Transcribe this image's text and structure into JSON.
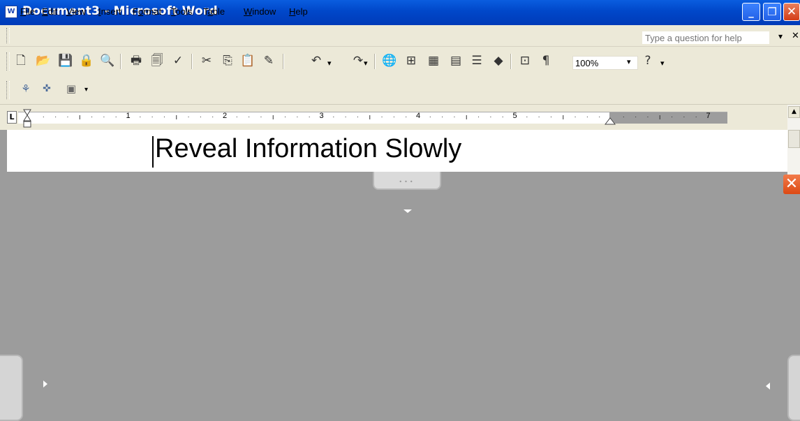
{
  "window": {
    "title": "Document3 - Microsoft Word",
    "app_icon": "word-doc-icon",
    "app_icon_text": "W",
    "minimize_glyph": "_",
    "maximize_glyph": "❐",
    "close_glyph": "✕"
  },
  "menu": {
    "items": [
      {
        "pre": "",
        "mn": "F",
        "post": "ile"
      },
      {
        "pre": "",
        "mn": "E",
        "post": "dit"
      },
      {
        "pre": "",
        "mn": "V",
        "post": "iew"
      },
      {
        "pre": "",
        "mn": "I",
        "post": "nsert"
      },
      {
        "pre": "F",
        "mn": "o",
        "post": "rmat"
      },
      {
        "pre": "",
        "mn": "T",
        "post": "ools"
      },
      {
        "pre": "T",
        "mn": "a",
        "post": "ble"
      },
      {
        "pre": "",
        "mn": "W",
        "post": "indow"
      },
      {
        "pre": "",
        "mn": "H",
        "post": "elp"
      }
    ],
    "help_placeholder": "Type a question for help",
    "help_dropdown_glyph": "▾",
    "close_doc_glyph": "✕"
  },
  "toolbar": {
    "standard_icons": [
      "new-document-icon",
      "open-folder-icon",
      "save-icon",
      "permission-icon",
      "research-icon",
      "print-icon",
      "print-preview-icon",
      "spelling-grammar-icon",
      "cut-icon",
      "copy-icon",
      "paste-icon",
      "format-painter-icon",
      "undo-icon",
      "redo-icon",
      "insert-hyperlink-icon",
      "tables-borders-icon",
      "insert-table-icon",
      "insert-excel-icon",
      "columns-icon",
      "drawing-icon",
      "document-map-icon",
      "show-formatting-icon",
      "help-icon"
    ],
    "zoom_value": "100%",
    "dropdown_glyph": "▾"
  },
  "ruler": {
    "numbers": [
      "1",
      "2",
      "3",
      "4",
      "5",
      "7"
    ],
    "tab_selector": "L"
  },
  "document": {
    "text": "Reveal Information Slowly"
  },
  "colors": {
    "title_bar": "#0047c9",
    "chrome": "#ece9d8",
    "workspace_gray": "#9c9c9c",
    "close_red": "#dc4a14"
  }
}
